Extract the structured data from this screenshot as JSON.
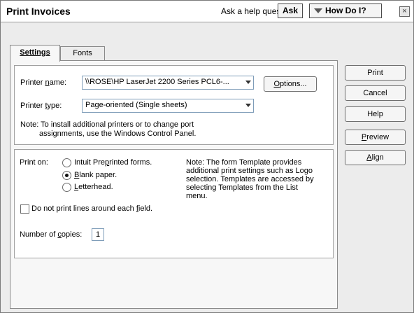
{
  "window": {
    "title": "Print Invoices",
    "help_prompt": "Ask a help question",
    "ask_label": "Ask",
    "how_do_i_label": "How Do I?",
    "close_glyph": "×"
  },
  "tabs": [
    {
      "label": "Settings",
      "active": true
    },
    {
      "label": "Fonts",
      "active": false
    }
  ],
  "printer": {
    "name_label": "Printer name:",
    "name_value": "\\\\ROSE\\HP LaserJet 2200 Series PCL6-...",
    "options_label": "Options...",
    "type_label": "Printer type:",
    "type_value": "Page-oriented (Single sheets)",
    "note_line1": "Note: To install additional printers or to change port",
    "note_line2": "assignments, use the Windows Control Panel."
  },
  "print_on": {
    "label": "Print on:",
    "options": [
      {
        "label": "Intuit Preprinted forms.",
        "selected": false
      },
      {
        "label": "Blank paper.",
        "selected": true
      },
      {
        "label": "Letterhead.",
        "selected": false
      }
    ],
    "template_note": [
      "Note: The form Template provides",
      "additional print settings such as Logo",
      "selection.  Templates are accessed by",
      "selecting Templates from the List",
      "menu."
    ],
    "lines_checkbox_label": "Do not print lines around each field.",
    "lines_checked": false,
    "copies_label": "Number of copies:",
    "copies_value": "1"
  },
  "actions": {
    "print": "Print",
    "cancel": "Cancel",
    "help": "Help",
    "preview": "Preview",
    "align": "Align"
  }
}
